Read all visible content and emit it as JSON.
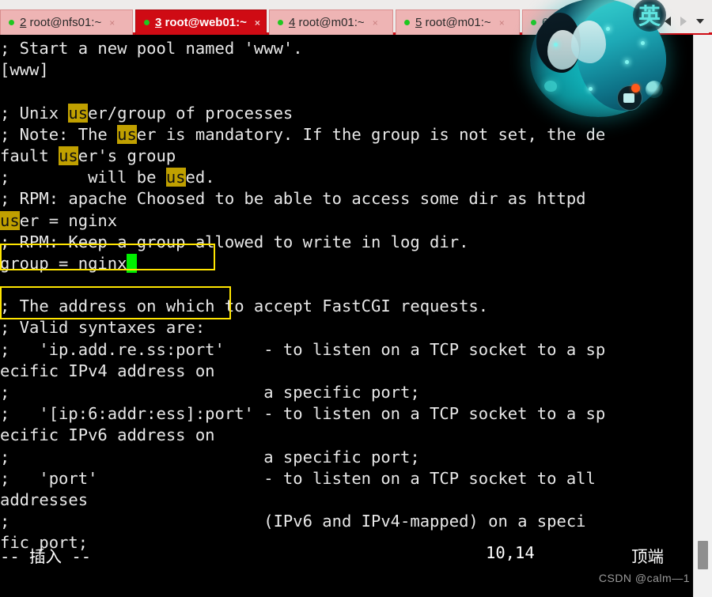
{
  "window": {
    "accent_color": "#cf0b14",
    "tab_inactive_color": "#eeb4b4",
    "terminal_bg": "#000000",
    "terminal_fg": "#e8e8e8",
    "highlight_color": "#c0a000",
    "cursor_color": "#00ef00",
    "annotation_color": "#ffe500"
  },
  "tabbar": {
    "tabs": [
      {
        "index": "2",
        "title": " root@nfs01:~",
        "active": false,
        "close_label": "×",
        "status_dot": "green"
      },
      {
        "index": "3",
        "title": " root@web01:~",
        "active": true,
        "close_label": "×",
        "status_dot": "green"
      },
      {
        "index": "4",
        "title": " root@m01:~",
        "active": false,
        "close_label": "×",
        "status_dot": "green"
      },
      {
        "index": "5",
        "title": " root@m01:~",
        "active": false,
        "close_label": "×",
        "status_dot": "green"
      },
      {
        "index": "6",
        "title": " ro",
        "active": false,
        "close_label": "",
        "status_dot": "green"
      }
    ],
    "nav": {
      "prev_icon": "left-arrow-icon",
      "next_icon": "right-arrow-icon",
      "menu_icon": "chevron-down-icon"
    }
  },
  "terminal": {
    "lines": [
      "; Start a new pool named 'www'.",
      "[www]",
      "",
      "; Unix user/group of processes",
      "; Note: The user is mandatory. If the group is not set, the de",
      "fault user's group",
      ";        will be used.",
      "; RPM: apache Choosed to be able to access some dir as httpd",
      "user = nginx",
      "; RPM: Keep a group allowed to write in log dir.",
      "group = nginx",
      "",
      "; The address on which to accept FastCGI requests.",
      "; Valid syntaxes are:",
      ";   'ip.add.re.ss:port'    - to listen on a TCP socket to a sp",
      "ecific IPv4 address on",
      ";                          a specific port;",
      ";   '[ip:6:addr:ess]:port' - to listen on a TCP socket to a sp",
      "ecific IPv6 address on",
      ";                          a specific port;",
      ";   'port'                 - to listen on a TCP socket to all",
      "addresses",
      ";                          (IPv6 and IPv4-mapped) on a speci",
      "fic port;"
    ],
    "search_term": "us",
    "cursor_char": " "
  },
  "statusline": {
    "mode": "-- 插入 --",
    "position": "10,14",
    "scroll": "顶端"
  },
  "annotations": {
    "box_user_label": "user = nginx",
    "box_group_label": "group = nginx"
  },
  "ime": {
    "mode_badge": "英",
    "art_name": "anime-character-artwork"
  },
  "watermark": {
    "text": "CSDN @calm—1"
  },
  "scrollbar": {
    "orientation": "vertical"
  }
}
